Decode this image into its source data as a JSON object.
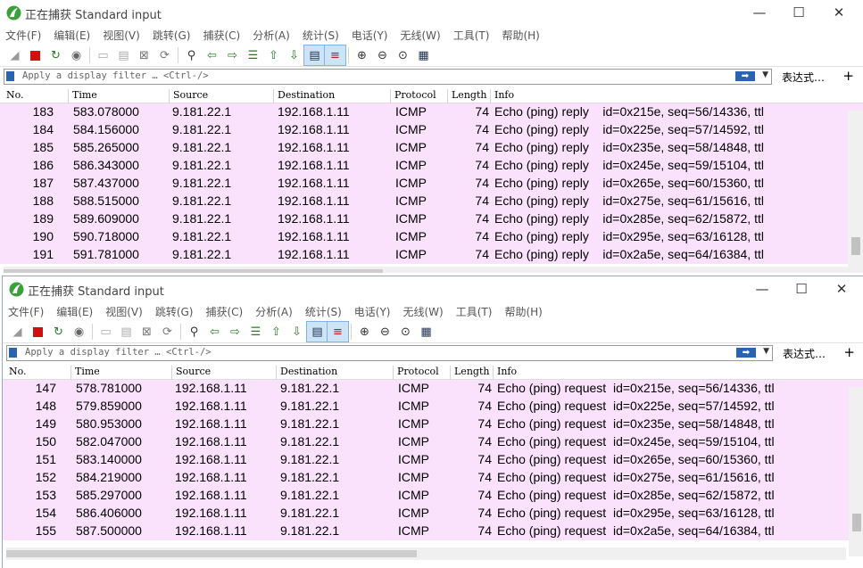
{
  "title": "正在捕获 Standard input",
  "window_controls": {
    "minimize": "—",
    "maximize": "☐",
    "close": "✕"
  },
  "menu": [
    "文件(F)",
    "编辑(E)",
    "视图(V)",
    "跳转(G)",
    "捕获(C)",
    "分析(A)",
    "统计(S)",
    "电话(Y)",
    "无线(W)",
    "工具(T)",
    "帮助(H)"
  ],
  "filter": {
    "placeholder": "Apply a display filter … <Ctrl-/>",
    "apply_arrow": "➡",
    "expression_label": "表达式…",
    "plus": "+"
  },
  "columns": [
    "No.",
    "Time",
    "Source",
    "Destination",
    "Protocol",
    "Length",
    "Info"
  ],
  "colors": {
    "row_bg": "#fbe2fc",
    "accent": "#2a64b0"
  },
  "toolbar_icons": [
    "shark-fin-start-icon",
    "stop-icon",
    "restart-icon",
    "options-icon",
    "open-icon",
    "save-icon",
    "close-file-icon",
    "reload-icon",
    "find-icon",
    "go-back-icon",
    "go-forward-icon",
    "go-to-packet-icon",
    "go-first-icon",
    "go-last-icon",
    "autoscroll-icon",
    "colorize-icon",
    "zoom-in-icon",
    "zoom-out-icon",
    "zoom-normal-icon",
    "resize-columns-icon"
  ],
  "top_packets": [
    {
      "no": "183",
      "time": "583.078000",
      "src": "9.181.22.1",
      "dst": "192.168.1.11",
      "proto": "ICMP",
      "len": "74",
      "info": "Echo (ping) reply    id=0x215e, seq=56/14336, ttl"
    },
    {
      "no": "184",
      "time": "584.156000",
      "src": "9.181.22.1",
      "dst": "192.168.1.11",
      "proto": "ICMP",
      "len": "74",
      "info": "Echo (ping) reply    id=0x225e, seq=57/14592, ttl"
    },
    {
      "no": "185",
      "time": "585.265000",
      "src": "9.181.22.1",
      "dst": "192.168.1.11",
      "proto": "ICMP",
      "len": "74",
      "info": "Echo (ping) reply    id=0x235e, seq=58/14848, ttl"
    },
    {
      "no": "186",
      "time": "586.343000",
      "src": "9.181.22.1",
      "dst": "192.168.1.11",
      "proto": "ICMP",
      "len": "74",
      "info": "Echo (ping) reply    id=0x245e, seq=59/15104, ttl"
    },
    {
      "no": "187",
      "time": "587.437000",
      "src": "9.181.22.1",
      "dst": "192.168.1.11",
      "proto": "ICMP",
      "len": "74",
      "info": "Echo (ping) reply    id=0x265e, seq=60/15360, ttl"
    },
    {
      "no": "188",
      "time": "588.515000",
      "src": "9.181.22.1",
      "dst": "192.168.1.11",
      "proto": "ICMP",
      "len": "74",
      "info": "Echo (ping) reply    id=0x275e, seq=61/15616, ttl"
    },
    {
      "no": "189",
      "time": "589.609000",
      "src": "9.181.22.1",
      "dst": "192.168.1.11",
      "proto": "ICMP",
      "len": "74",
      "info": "Echo (ping) reply    id=0x285e, seq=62/15872, ttl"
    },
    {
      "no": "190",
      "time": "590.718000",
      "src": "9.181.22.1",
      "dst": "192.168.1.11",
      "proto": "ICMP",
      "len": "74",
      "info": "Echo (ping) reply    id=0x295e, seq=63/16128, ttl"
    },
    {
      "no": "191",
      "time": "591.781000",
      "src": "9.181.22.1",
      "dst": "192.168.1.11",
      "proto": "ICMP",
      "len": "74",
      "info": "Echo (ping) reply    id=0x2a5e, seq=64/16384, ttl"
    }
  ],
  "bottom_packets": [
    {
      "no": "147",
      "time": "578.781000",
      "src": "192.168.1.11",
      "dst": "9.181.22.1",
      "proto": "ICMP",
      "len": "74",
      "info": "Echo (ping) request  id=0x215e, seq=56/14336, ttl"
    },
    {
      "no": "148",
      "time": "579.859000",
      "src": "192.168.1.11",
      "dst": "9.181.22.1",
      "proto": "ICMP",
      "len": "74",
      "info": "Echo (ping) request  id=0x225e, seq=57/14592, ttl"
    },
    {
      "no": "149",
      "time": "580.953000",
      "src": "192.168.1.11",
      "dst": "9.181.22.1",
      "proto": "ICMP",
      "len": "74",
      "info": "Echo (ping) request  id=0x235e, seq=58/14848, ttl"
    },
    {
      "no": "150",
      "time": "582.047000",
      "src": "192.168.1.11",
      "dst": "9.181.22.1",
      "proto": "ICMP",
      "len": "74",
      "info": "Echo (ping) request  id=0x245e, seq=59/15104, ttl"
    },
    {
      "no": "151",
      "time": "583.140000",
      "src": "192.168.1.11",
      "dst": "9.181.22.1",
      "proto": "ICMP",
      "len": "74",
      "info": "Echo (ping) request  id=0x265e, seq=60/15360, ttl"
    },
    {
      "no": "152",
      "time": "584.219000",
      "src": "192.168.1.11",
      "dst": "9.181.22.1",
      "proto": "ICMP",
      "len": "74",
      "info": "Echo (ping) request  id=0x275e, seq=61/15616, ttl"
    },
    {
      "no": "153",
      "time": "585.297000",
      "src": "192.168.1.11",
      "dst": "9.181.22.1",
      "proto": "ICMP",
      "len": "74",
      "info": "Echo (ping) request  id=0x285e, seq=62/15872, ttl"
    },
    {
      "no": "154",
      "time": "586.406000",
      "src": "192.168.1.11",
      "dst": "9.181.22.1",
      "proto": "ICMP",
      "len": "74",
      "info": "Echo (ping) request  id=0x295e, seq=63/16128, ttl"
    },
    {
      "no": "155",
      "time": "587.500000",
      "src": "192.168.1.11",
      "dst": "9.181.22.1",
      "proto": "ICMP",
      "len": "74",
      "info": "Echo (ping) request  id=0x2a5e, seq=64/16384, ttl"
    }
  ]
}
